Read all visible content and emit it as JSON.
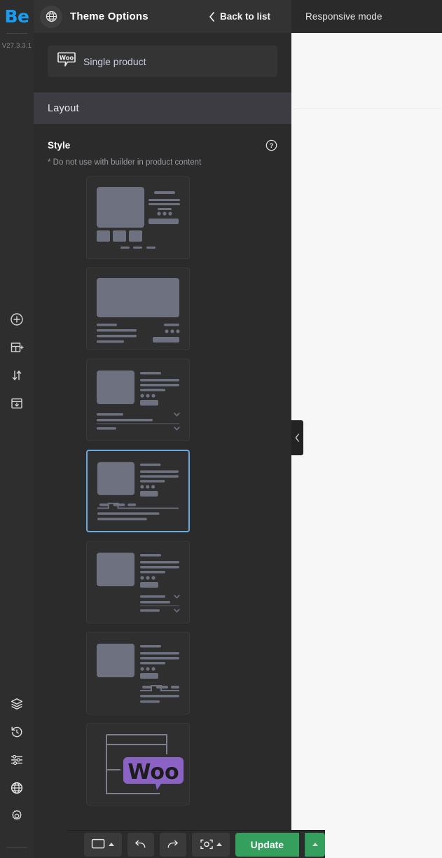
{
  "brand": {
    "logo_text": "Be",
    "version": "V27.3.3.1",
    "accent_color": "#189df3"
  },
  "rail": {
    "middle_items": [
      {
        "icon": "plus-circle-icon",
        "name": "add-element"
      },
      {
        "icon": "add-section-icon",
        "name": "add-section"
      },
      {
        "icon": "sort-arrows-icon",
        "name": "reorder-sections"
      },
      {
        "icon": "save-template-icon",
        "name": "save-template"
      }
    ],
    "bottom_items": [
      {
        "icon": "layers-icon",
        "name": "layers"
      },
      {
        "icon": "history-icon",
        "name": "history"
      },
      {
        "icon": "sliders-icon",
        "name": "global-settings"
      },
      {
        "icon": "globe-icon",
        "name": "theme-options"
      },
      {
        "icon": "gear-icon",
        "name": "settings"
      }
    ]
  },
  "panel": {
    "icon": "globe-icon",
    "title": "Theme Options",
    "back": {
      "label": "Back to list",
      "icon": "chevron-left-icon"
    },
    "object_card": {
      "icon": "woo-icon",
      "label": "Single product"
    },
    "section": {
      "label": "Layout"
    },
    "field": {
      "label": "Style",
      "help_icon": "question-circle-icon",
      "note": "* Do not use with builder in product content"
    },
    "styles": [
      {
        "name": "style-option-1",
        "selected": false,
        "variant": "gallery-thumbs-below"
      },
      {
        "name": "style-option-2",
        "selected": false,
        "variant": "wide-image-top"
      },
      {
        "name": "style-option-3",
        "selected": false,
        "variant": "accordion-left"
      },
      {
        "name": "style-option-4",
        "selected": true,
        "variant": "tabs-left"
      },
      {
        "name": "style-option-5",
        "selected": false,
        "variant": "accordion-right"
      },
      {
        "name": "style-option-6",
        "selected": false,
        "variant": "tabs-right"
      },
      {
        "name": "style-option-7",
        "selected": false,
        "variant": "woocommerce-default"
      }
    ],
    "collapse_handle_icon": "chevron-left-icon"
  },
  "preview": {
    "responsive_mode_label": "Responsive mode"
  },
  "toolbar": {
    "items": [
      {
        "name": "viewport-desktop-button",
        "icon": "monitor-icon",
        "has_caret": true
      },
      {
        "name": "undo-button",
        "icon": "undo-arrow-icon",
        "has_caret": false
      },
      {
        "name": "redo-button",
        "icon": "redo-arrow-icon",
        "has_caret": false
      },
      {
        "name": "preview-button",
        "icon": "preview-frame-icon",
        "has_caret": true
      }
    ],
    "update_label": "Update",
    "update_color": "#35a05e"
  }
}
